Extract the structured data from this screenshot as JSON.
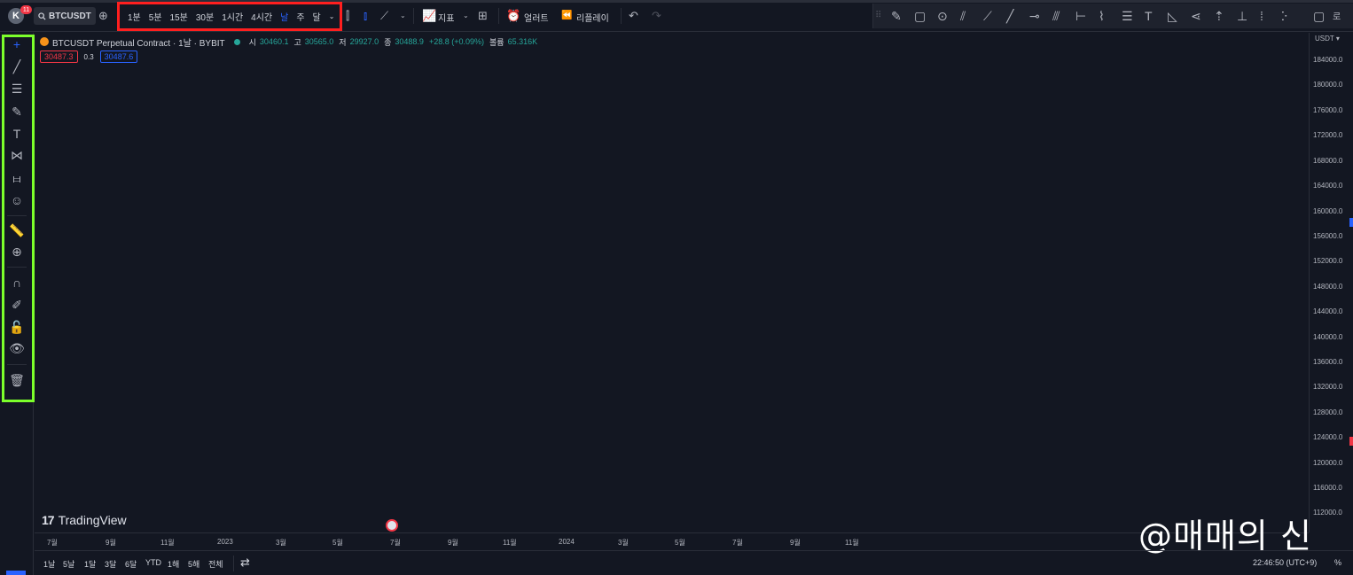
{
  "header": {
    "avatar_initial": "K",
    "notification_count": "11",
    "symbol": "BTCUSDT",
    "intervals": [
      "1분",
      "5분",
      "15분",
      "30분",
      "1시간",
      "4시간",
      "날",
      "주",
      "달"
    ],
    "active_interval": "날",
    "indicators_label": "지표",
    "alert_label": "얼러트",
    "replay_label": "리플레이",
    "drawbar_right_label": "로"
  },
  "legend": {
    "title": "BTCUSDT Perpetual Contract · 1날 · BYBIT",
    "ohlc": [
      {
        "label": "시",
        "value": "30460.1"
      },
      {
        "label": "고",
        "value": "30565.0"
      },
      {
        "label": "저",
        "value": "29927.0"
      },
      {
        "label": "종",
        "value": "30488.9"
      }
    ],
    "change": "+28.8 (+0.09%)",
    "volume_label": "볼륨",
    "volume": "65.316K",
    "sell_price": "30487.3",
    "spread": "0.3",
    "buy_price": "30487.6"
  },
  "price_axis": {
    "currency": "USDT",
    "labels": [
      "184000.0",
      "180000.0",
      "176000.0",
      "172000.0",
      "168000.0",
      "164000.0",
      "160000.0",
      "156000.0",
      "152000.0",
      "148000.0",
      "144000.0",
      "140000.0",
      "136000.0",
      "132000.0",
      "128000.0",
      "124000.0",
      "120000.0",
      "116000.0",
      "112000.0"
    ]
  },
  "time_axis": {
    "labels": [
      "7월",
      "9월",
      "11월",
      "2023",
      "3월",
      "5월",
      "7월",
      "9월",
      "11월",
      "2024",
      "3월",
      "5월",
      "7월",
      "9월",
      "11월"
    ]
  },
  "branding": {
    "logo_text": "TradingView",
    "watermark": "@매매의 신"
  },
  "bottom": {
    "ranges": [
      "1날",
      "5날",
      "1달",
      "3달",
      "6달",
      "YTD",
      "1해",
      "5해",
      "전체"
    ],
    "clock": "22:46:50 (UTC+9)",
    "percent": "%"
  },
  "colors": {
    "background": "#131722",
    "accent": "#2962ff",
    "up": "#26a69a",
    "down": "#f23645",
    "highlight_red": "#ff1f1f",
    "highlight_green": "#7cff2b"
  }
}
